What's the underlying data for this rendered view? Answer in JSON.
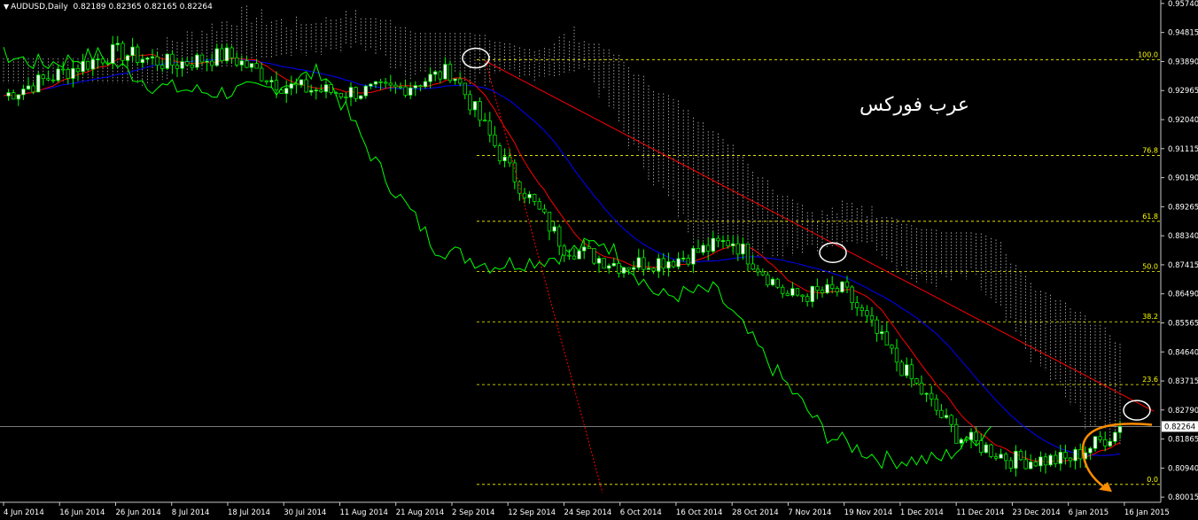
{
  "header": {
    "symbol": "AUDUSD,Daily",
    "ohlc": "0.82189 0.82365 0.82165 0.82264"
  },
  "watermark": "عرب فوركس",
  "colors": {
    "background": "#000000",
    "grid_axis": "#c8c8c8",
    "bull_candle": "#ffffff",
    "bear_candle": "#ffffff",
    "candle_wick": "#00ff00",
    "tenkan": "#ff0000",
    "kijun": "#0000ff",
    "chikou": "#00ff00",
    "cloud": "#ffffff",
    "fib_line": "#ffff00",
    "fib_label": "#ffff00",
    "trendline": "#ff0000",
    "price_line": "#c0c0c0",
    "annotation_circle": "#ffffff",
    "annotation_arrow": "#ff8c00"
  },
  "chart_data": {
    "type": "candlestick",
    "title": "AUDUSD,Daily",
    "current_price": 0.82264,
    "y_ticks": [
      0.9574,
      0.94815,
      0.9389,
      0.92965,
      0.9204,
      0.91115,
      0.9019,
      0.89265,
      0.8834,
      0.87415,
      0.8649,
      0.85565,
      0.8464,
      0.83715,
      0.8279,
      0.81865,
      0.8094,
      0.80015
    ],
    "y_tick_labels": [
      "0.95740",
      "0.94815",
      "0.93890",
      "0.92965",
      "0.92040",
      "0.91115",
      "0.90190",
      "0.89265",
      "0.88340",
      "0.87415",
      "0.86490",
      "0.85565",
      "0.84640",
      "0.83715",
      "0.82790",
      "0.81865",
      "0.80940",
      "0.80015"
    ],
    "ylim": [
      0.7985,
      0.9585
    ],
    "x_labels": [
      "4 Jun 2014",
      "16 Jun 2014",
      "26 Jun 2014",
      "8 Jul 2014",
      "18 Jul 2014",
      "30 Jul 2014",
      "11 Aug 2014",
      "21 Aug 2014",
      "2 Sep 2014",
      "12 Sep 2014",
      "24 Sep 2014",
      "6 Oct 2014",
      "16 Oct 2014",
      "28 Oct 2014",
      "7 Nov 2014",
      "19 Nov 2014",
      "1 Dec 2014",
      "11 Dec 2014",
      "23 Dec 2014",
      "6 Jan 2015",
      "16 Jan 2015"
    ],
    "fibonacci": [
      {
        "label": "100.0",
        "price": 0.9395
      },
      {
        "label": "76.8",
        "price": 0.909
      },
      {
        "label": "61.8",
        "price": 0.888
      },
      {
        "label": "50.0",
        "price": 0.872
      },
      {
        "label": "38.2",
        "price": 0.856
      },
      {
        "label": "23.6",
        "price": 0.836
      },
      {
        "label": "0.0",
        "price": 0.8042
      }
    ],
    "price_anchors": [
      {
        "date": "4 Jun 2014",
        "price": 0.928
      },
      {
        "date": "16 Jun 2014",
        "price": 0.935
      },
      {
        "date": "26 Jun 2014",
        "price": 0.942
      },
      {
        "date": "8 Jul 2014",
        "price": 0.938
      },
      {
        "date": "18 Jul 2014",
        "price": 0.941
      },
      {
        "date": "30 Jul 2014",
        "price": 0.931
      },
      {
        "date": "11 Aug 2014",
        "price": 0.929
      },
      {
        "date": "21 Aug 2014",
        "price": 0.93
      },
      {
        "date": "2 Sep 2014",
        "price": 0.936
      },
      {
        "date": "12 Sep 2014",
        "price": 0.905
      },
      {
        "date": "24 Sep 2014",
        "price": 0.88
      },
      {
        "date": "6 Oct 2014",
        "price": 0.874
      },
      {
        "date": "16 Oct 2014",
        "price": 0.876
      },
      {
        "date": "28 Oct 2014",
        "price": 0.882
      },
      {
        "date": "7 Nov 2014",
        "price": 0.864
      },
      {
        "date": "19 Nov 2014",
        "price": 0.866
      },
      {
        "date": "1 Dec 2014",
        "price": 0.842
      },
      {
        "date": "11 Dec 2014",
        "price": 0.82
      },
      {
        "date": "23 Dec 2014",
        "price": 0.812
      },
      {
        "date": "6 Jan 2015",
        "price": 0.812
      },
      {
        "date": "16 Jan 2015",
        "price": 0.8226
      }
    ]
  }
}
